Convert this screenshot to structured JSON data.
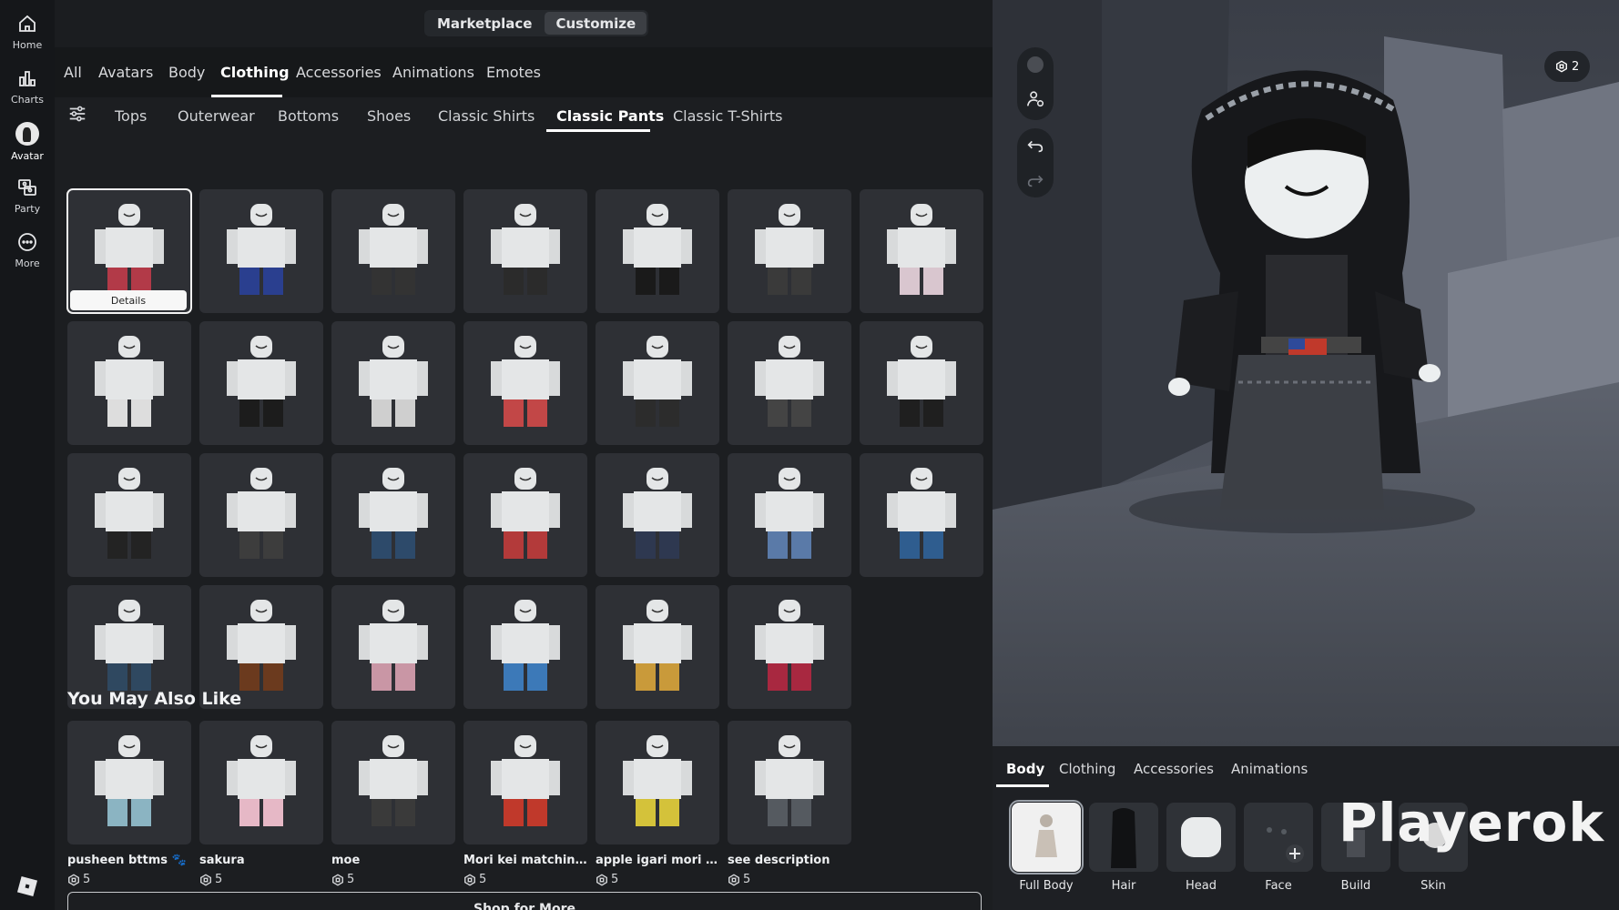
{
  "rail": {
    "items": [
      {
        "label": "Home",
        "icon": "home-icon"
      },
      {
        "label": "Charts",
        "icon": "charts-icon"
      },
      {
        "label": "Avatar",
        "icon": "avatar-icon"
      },
      {
        "label": "Party",
        "icon": "party-icon"
      },
      {
        "label": "More",
        "icon": "more-icon"
      }
    ]
  },
  "mode_switch": {
    "marketplace": "Marketplace",
    "customize": "Customize"
  },
  "tabs": [
    "All",
    "Avatars",
    "Body",
    "Clothing",
    "Accessories",
    "Animations",
    "Emotes"
  ],
  "subtabs": [
    "Tops",
    "Outerwear",
    "Bottoms",
    "Shoes",
    "Classic Shirts",
    "Classic Pants",
    "Classic T-Shirts"
  ],
  "details_label": "Details",
  "grid_colors": [
    "#b23a48",
    "#2a3f8f",
    "#333333",
    "#2b2b2b",
    "#1a1a1a",
    "#3a3a3a",
    "#d9c6cf",
    "#dddddd",
    "#1c1c1c",
    "#cfcfcf",
    "#c24747",
    "#2c2c2c",
    "#444444",
    "#1f1f1f",
    "#232323",
    "#3d3d3d",
    "#2d4a6a",
    "#b33a3a",
    "#2e3850",
    "#5a7aa8",
    "#2f5d8f",
    "#2f4860",
    "#6b3a1e",
    "#c996a5",
    "#3c79b8",
    "#c99a3a",
    "#a82840"
  ],
  "recommended": {
    "title": "You May Also Like",
    "items": [
      {
        "name": "pusheen bttms 🐾",
        "price": "5",
        "color": "#8bb4c2"
      },
      {
        "name": "sakura",
        "price": "5",
        "color": "#e6b8c6"
      },
      {
        "name": "moe",
        "price": "5",
        "color": "#3a3a3a"
      },
      {
        "name": "Mori kei matching ...",
        "price": "5",
        "color": "#c0392b"
      },
      {
        "name": "apple igari mori kei ...",
        "price": "5",
        "color": "#d4c23a"
      },
      {
        "name": "see description",
        "price": "5",
        "color": "#555a60"
      }
    ],
    "shop_more": "Shop for More"
  },
  "robux_count": "2",
  "bottom_panel": {
    "tabs": [
      "Body",
      "Clothing",
      "Accessories",
      "Animations"
    ],
    "categories": [
      "Full Body",
      "Hair",
      "Head",
      "Face",
      "Build",
      "Skin"
    ]
  },
  "watermark": "Playerok"
}
